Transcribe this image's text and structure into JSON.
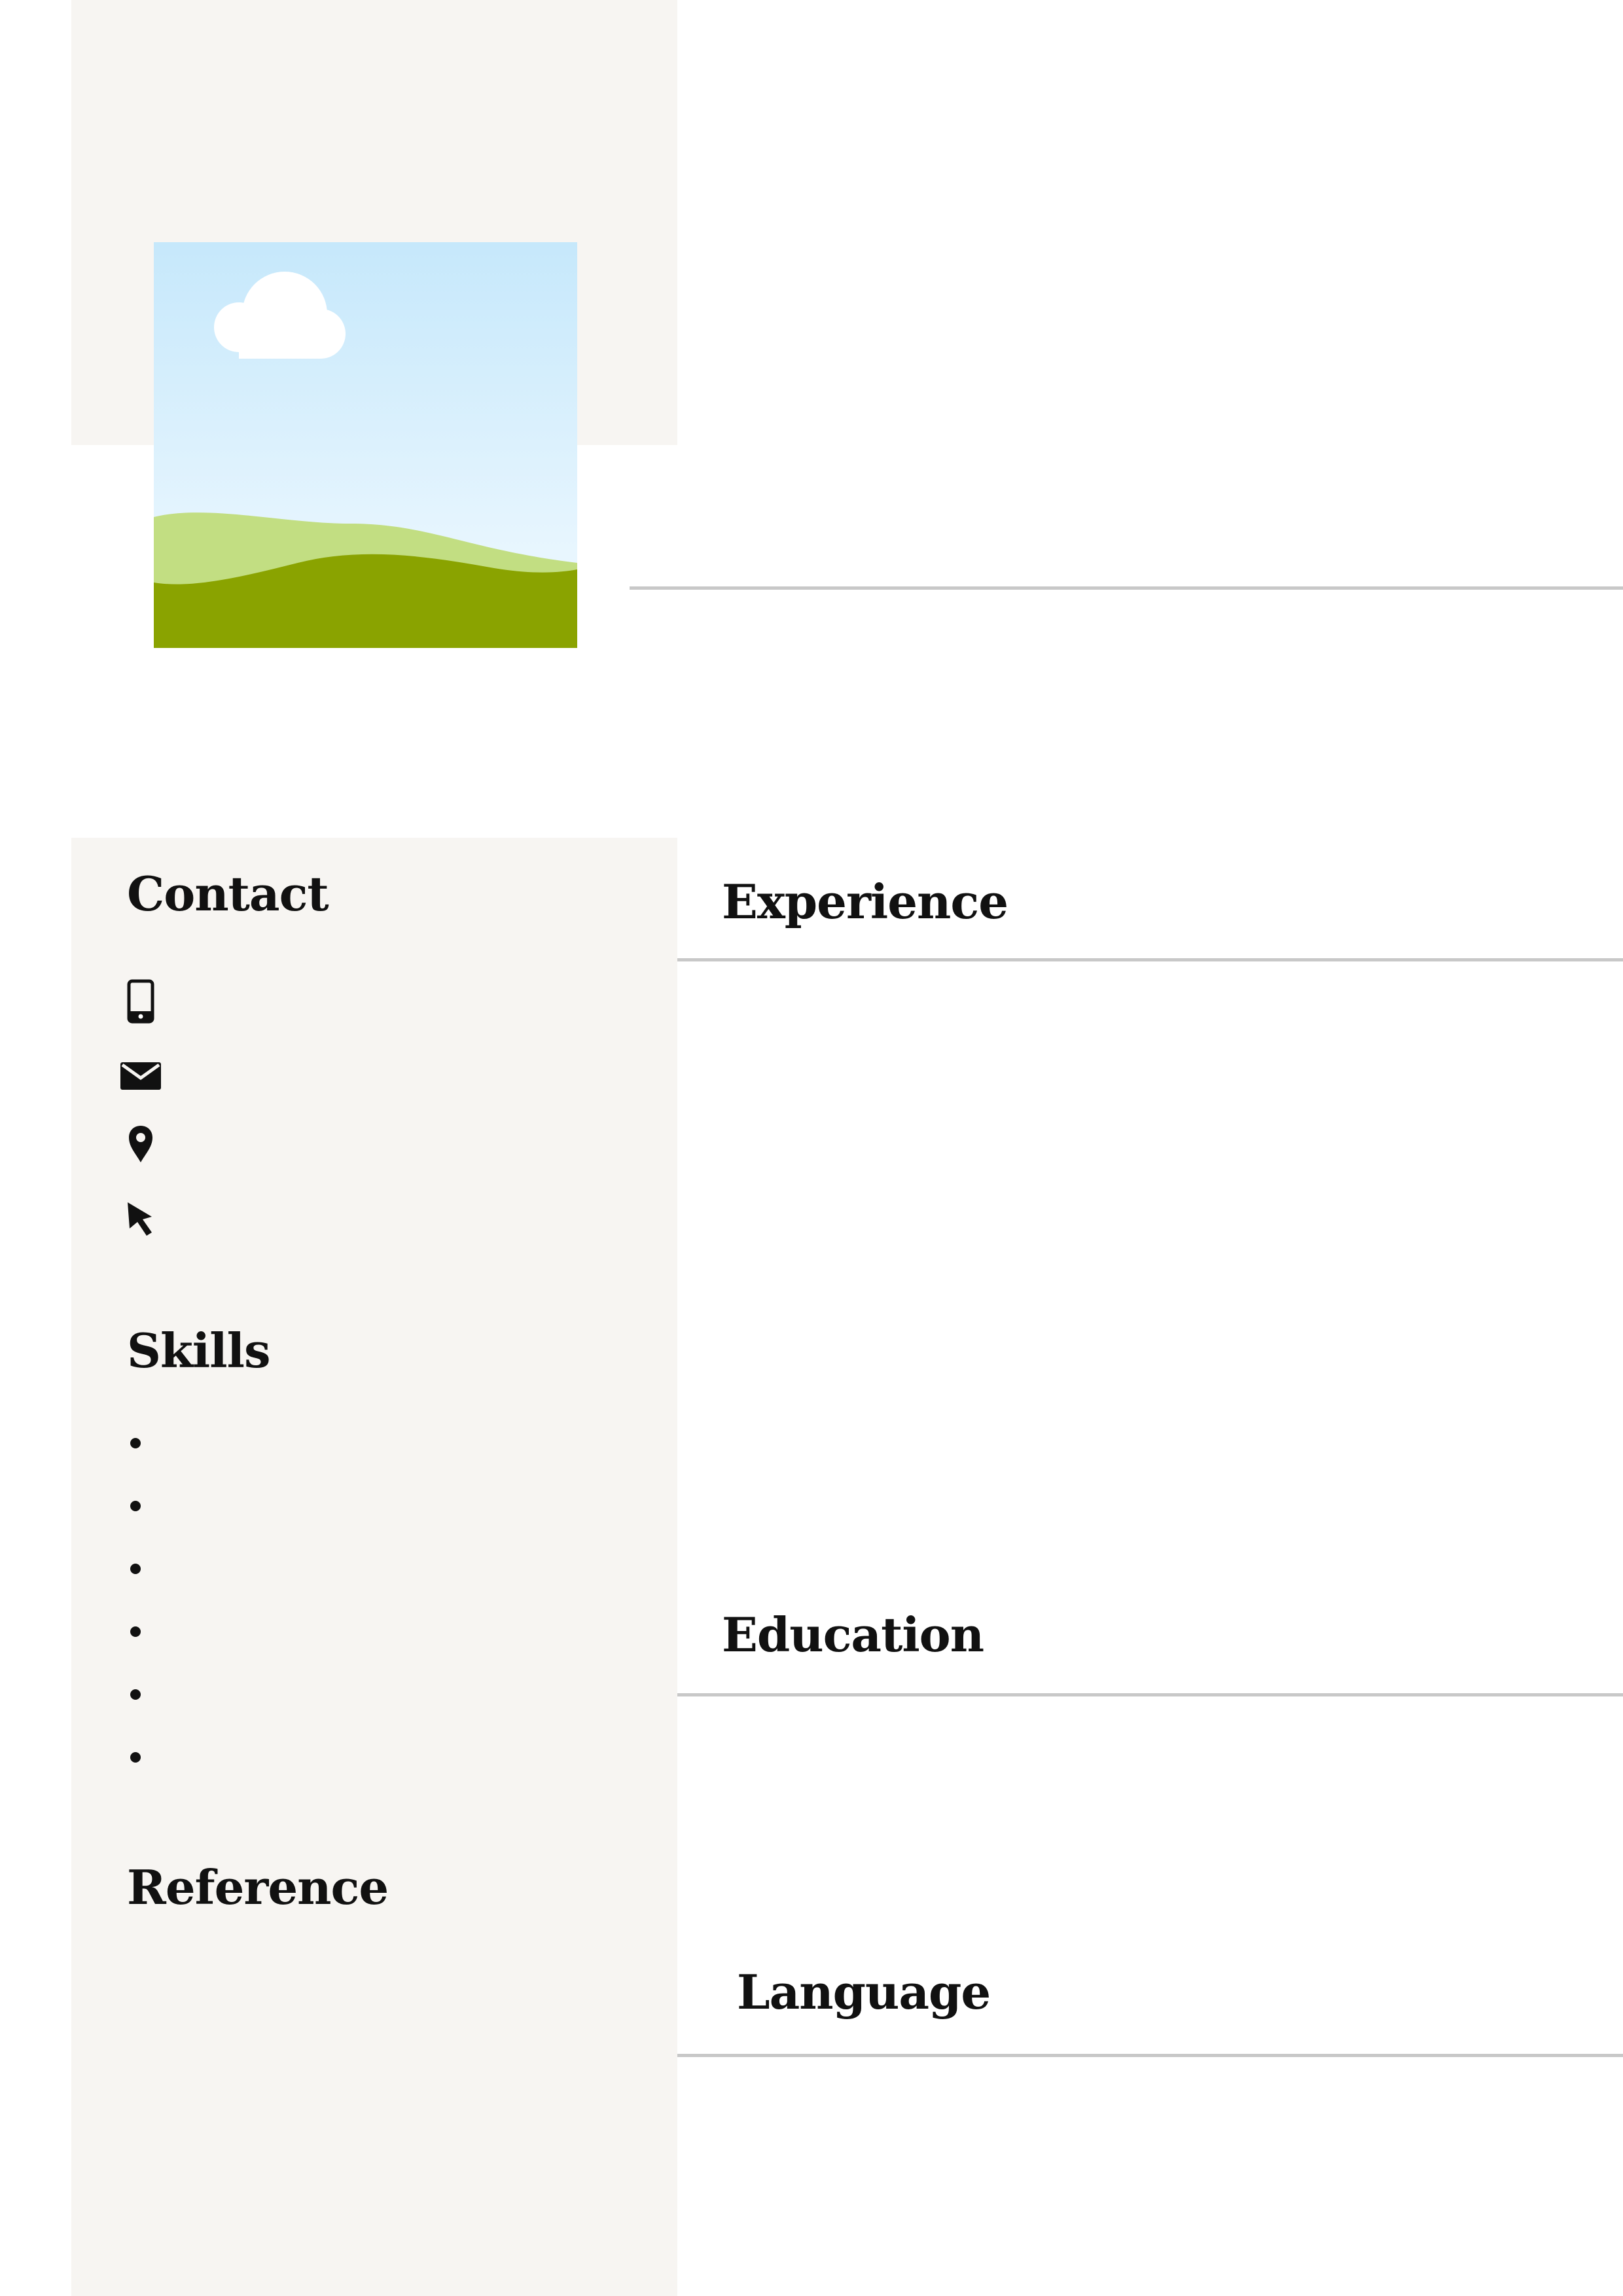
{
  "contact": {
    "heading": "Contact",
    "icons": [
      "phone-icon",
      "email-icon",
      "location-icon",
      "cursor-icon"
    ]
  },
  "skills": {
    "heading": "Skills",
    "bullet_count": 6
  },
  "reference": {
    "heading": "Reference"
  },
  "experience": {
    "heading": "Experience"
  },
  "education": {
    "heading": "Education"
  },
  "language": {
    "heading": "Language"
  },
  "colors": {
    "sidebar_bg": "#f7f5f2",
    "rule": "#c8c8c8",
    "heading_text": "#111111",
    "sky": "#cde9fb",
    "hill_light": "#c2de82",
    "hill_dark": "#8aa300",
    "cloud": "#ffffff"
  },
  "photo": {
    "description_icon": "landscape-placeholder-icon"
  }
}
